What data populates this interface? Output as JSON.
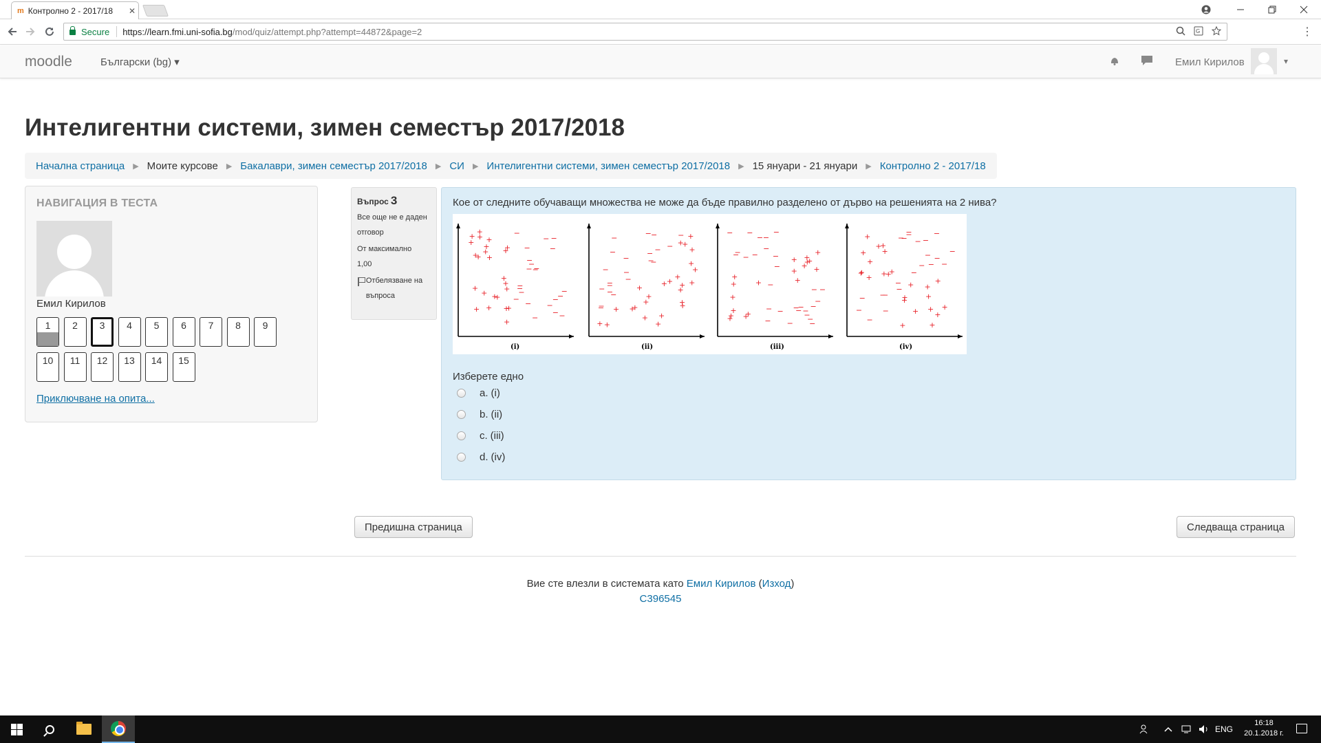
{
  "browser": {
    "tab_title": "Контролно 2 - 2017/18",
    "tab_close": "✕",
    "secure_label": "Secure",
    "url_host": "https://learn.fmi.uni-sofia.bg",
    "url_path": "/mod/quiz/attempt.php?attempt=44872&page=2",
    "back_icon": "arrow-left-icon",
    "forward_icon": "arrow-right-icon",
    "reload_icon": "reload-icon"
  },
  "header": {
    "brand": "moodle",
    "language": "Български (bg) ▾",
    "user_name": "Емил Кирилов",
    "caret": "▾"
  },
  "page": {
    "title": "Интелигентни системи, зимен семестър 2017/2018"
  },
  "breadcrumb": [
    {
      "label": "Начална страница",
      "link": true
    },
    {
      "label": "Моите курсове",
      "link": false
    },
    {
      "label": "Бакалаври, зимен семестър 2017/2018",
      "link": true
    },
    {
      "label": "СИ",
      "link": true
    },
    {
      "label": "Интелигентни системи, зимен семестър 2017/2018",
      "link": true
    },
    {
      "label": "15 януари - 21 януари",
      "link": false
    },
    {
      "label": "Контролно 2 - 2017/18",
      "link": true
    }
  ],
  "quiz_nav": {
    "heading": "НАВИГАЦИЯ В ТЕСТА",
    "user_name": "Емил Кирилов",
    "questions": [
      "1",
      "2",
      "3",
      "4",
      "5",
      "6",
      "7",
      "8",
      "9",
      "10",
      "11",
      "12",
      "13",
      "14",
      "15"
    ],
    "answered": [
      "1"
    ],
    "current": "3",
    "finish_link": "Приключване на опита..."
  },
  "question_info": {
    "label": "Въпрос",
    "number": "3",
    "state": "Все още не е даден отговор",
    "max_label": "От максимално",
    "max_value": "1,00",
    "flag_label": "Отбелязване на въпроса"
  },
  "question": {
    "text": "Кое от следните обучаващи множества не може да бъде правилно разделено от дърво на решенията на 2 нива?",
    "plot_labels": [
      "(i)",
      "(ii)",
      "(iii)",
      "(iv)"
    ],
    "plus_color": "#e8232a",
    "prompt": "Изберете едно",
    "answers": [
      {
        "letter": "a.",
        "label": "(i)"
      },
      {
        "letter": "b.",
        "label": "(ii)"
      },
      {
        "letter": "c.",
        "label": "(iii)"
      },
      {
        "letter": "d.",
        "label": "(iv)"
      }
    ]
  },
  "nav_buttons": {
    "prev": "Предишна страница",
    "next": "Следваща страница"
  },
  "footer": {
    "logged_in_prefix": "Вие сте влезли в системата като",
    "user_link": "Емил Кирилов",
    "logout": "Изход",
    "code": "C396545"
  },
  "taskbar": {
    "lang": "ENG",
    "time": "16:18",
    "date": "20.1.2018 г."
  },
  "colors": {
    "link": "#0f6fa4",
    "question_bg": "#dcedf7"
  }
}
